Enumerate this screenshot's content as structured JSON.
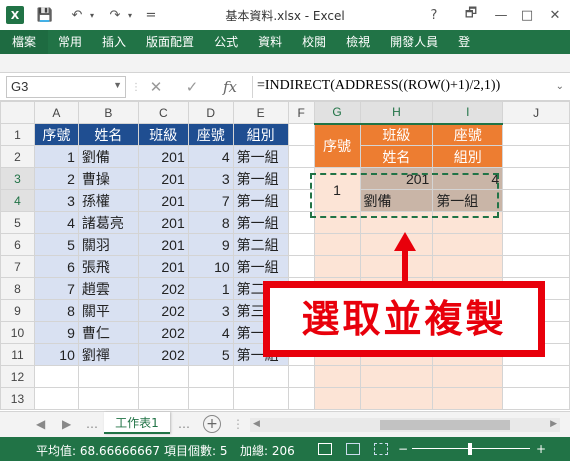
{
  "window": {
    "logo": "X",
    "doc_title": "基本資料.xlsx - Excel",
    "help": "?",
    "restore": "🗗",
    "minimize": "—",
    "maximize": "□",
    "close": "✕"
  },
  "qat": {
    "save": "💾",
    "undo": "↶",
    "redo": "↷",
    "more": "="
  },
  "ribbon_tabs": [
    "檔案",
    "常用",
    "插入",
    "版面配置",
    "公式",
    "資料",
    "校閱",
    "檢視",
    "開發人員",
    "登"
  ],
  "formula_bar": {
    "name_box": "G3",
    "cancel": "✕",
    "enter": "✓",
    "fx": "fx",
    "formula": "=INDIRECT(ADDRESS((ROW()+1)/2,1))",
    "expand": "⌄"
  },
  "columns": [
    "A",
    "B",
    "C",
    "D",
    "E",
    "F",
    "G",
    "H",
    "I",
    "J"
  ],
  "rows": [
    [
      "序號",
      "姓名",
      "班級",
      "座號",
      "組別",
      "",
      "序號",
      "班級",
      "座號",
      ""
    ],
    [
      "1",
      "劉備",
      "201",
      "4",
      "第一組",
      "",
      "",
      "姓名",
      "組別",
      ""
    ],
    [
      "2",
      "曹操",
      "201",
      "3",
      "第一組",
      "",
      "1",
      "201",
      "4",
      ""
    ],
    [
      "3",
      "孫權",
      "201",
      "7",
      "第一組",
      "",
      "",
      "劉備",
      "第一組",
      ""
    ],
    [
      "4",
      "諸葛亮",
      "201",
      "8",
      "第一組",
      "",
      "",
      "",
      "",
      ""
    ],
    [
      "5",
      "關羽",
      "201",
      "9",
      "第二組",
      "",
      "",
      "",
      "",
      ""
    ],
    [
      "6",
      "張飛",
      "201",
      "10",
      "第一組",
      "",
      "",
      "",
      "",
      ""
    ],
    [
      "7",
      "趙雲",
      "202",
      "1",
      "第二組",
      "",
      "",
      "",
      "",
      ""
    ],
    [
      "8",
      "關平",
      "202",
      "3",
      "第三組",
      "",
      "",
      "",
      "",
      ""
    ],
    [
      "9",
      "曹仁",
      "202",
      "4",
      "第一組",
      "",
      "",
      "",
      "",
      ""
    ],
    [
      "10",
      "劉禪",
      "202",
      "5",
      "第一組",
      "",
      "",
      "",
      "",
      ""
    ],
    [
      "",
      "",
      "",
      "",
      "",
      "",
      "",
      "",
      "",
      ""
    ],
    [
      "",
      "",
      "",
      "",
      "",
      "",
      "",
      "",
      "",
      ""
    ]
  ],
  "sheet_tabs": {
    "active": "工作表1",
    "add": "+",
    "nav_prev": "◀",
    "nav_next": "▶"
  },
  "status": {
    "average": "平均值: 68.66666667",
    "count": "項目個數: 5",
    "sum": "加總: 206"
  },
  "callout": "選取並複製",
  "colors": {
    "excel_green": "#217346",
    "header_blue": "#1f4e91",
    "light_blue": "#d9e1f2",
    "orange": "#ed7d31",
    "light_orange": "#fce4d6",
    "selection_brown": "#c9b5a7",
    "callout_red": "#e8000b"
  }
}
